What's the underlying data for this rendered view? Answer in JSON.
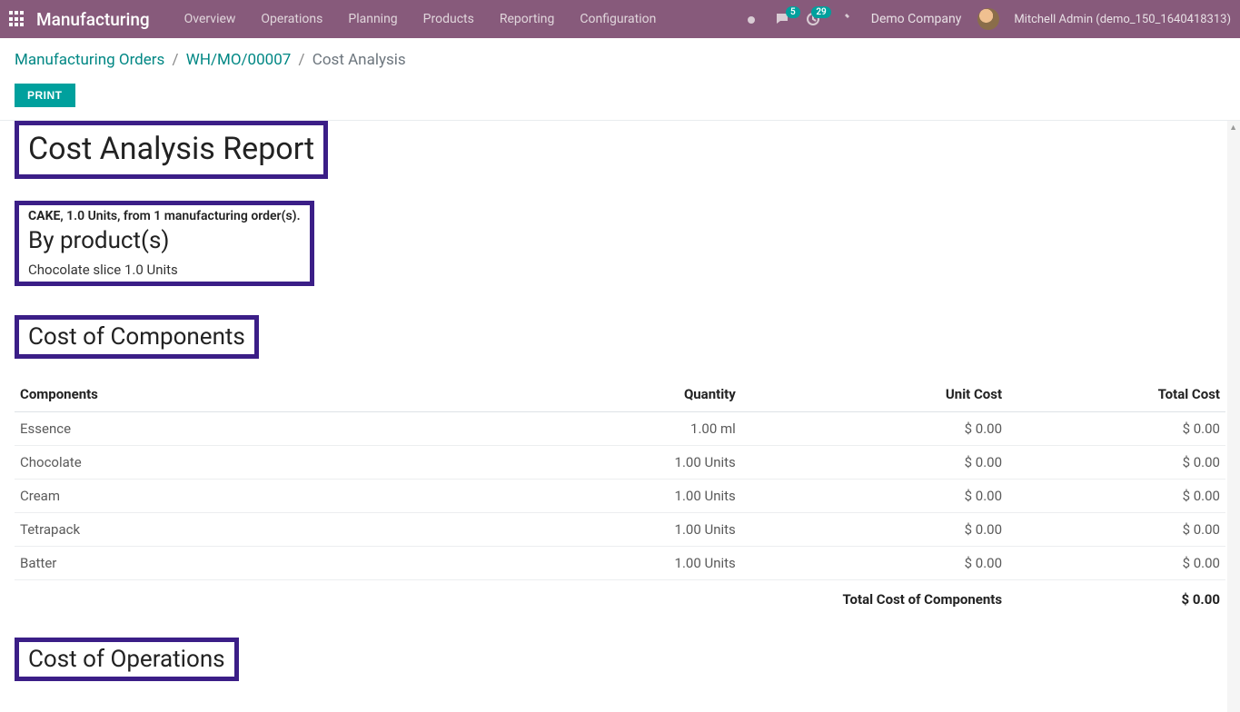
{
  "nav": {
    "brand": "Manufacturing",
    "menu": [
      "Overview",
      "Operations",
      "Planning",
      "Products",
      "Reporting",
      "Configuration"
    ],
    "chat_badge": "5",
    "clock_badge": "29",
    "company": "Demo Company",
    "user": "Mitchell Admin (demo_150_1640418313)"
  },
  "breadcrumb": {
    "items": [
      "Manufacturing Orders",
      "WH/MO/00007"
    ],
    "current": "Cost Analysis"
  },
  "actions": {
    "print": "PRINT"
  },
  "report": {
    "title": "Cost Analysis Report",
    "summary_product": "CAKE",
    "summary_rest": ", 1.0 Units, from 1 manufacturing order(s).",
    "byproducts_title": "By product(s)",
    "byproducts": [
      "Chocolate slice 1.0 Units"
    ],
    "components": {
      "title": "Cost of Components",
      "headers": {
        "name": "Components",
        "qty": "Quantity",
        "unit": "Unit Cost",
        "total": "Total Cost"
      },
      "rows": [
        {
          "name": "Essence",
          "qty": "1.00 ml",
          "unit": "$ 0.00",
          "total": "$ 0.00"
        },
        {
          "name": "Chocolate",
          "qty": "1.00 Units",
          "unit": "$ 0.00",
          "total": "$ 0.00"
        },
        {
          "name": "Cream",
          "qty": "1.00 Units",
          "unit": "$ 0.00",
          "total": "$ 0.00"
        },
        {
          "name": "Tetrapack",
          "qty": "1.00 Units",
          "unit": "$ 0.00",
          "total": "$ 0.00"
        },
        {
          "name": "Batter",
          "qty": "1.00 Units",
          "unit": "$ 0.00",
          "total": "$ 0.00"
        }
      ],
      "total_label": "Total Cost of Components",
      "total_value": "$ 0.00"
    },
    "operations": {
      "title": "Cost of Operations"
    }
  }
}
